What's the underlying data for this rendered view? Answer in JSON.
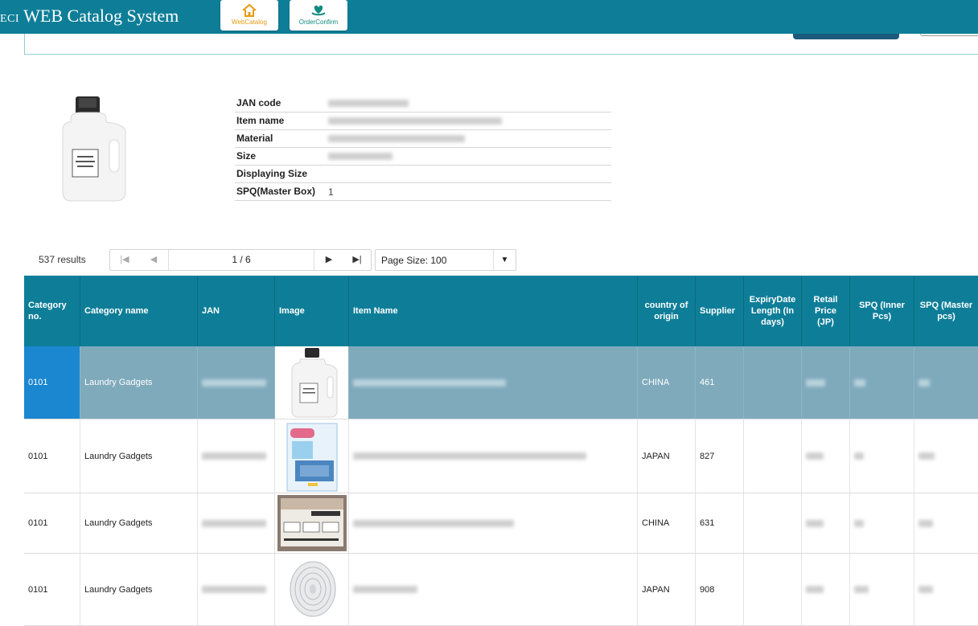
{
  "header": {
    "brand_prefix": "ECI",
    "brand_title": "WEB Catalog System",
    "nav": [
      {
        "label": "WebCatalog",
        "icon": "home-icon"
      },
      {
        "label": "OrderConfirm",
        "icon": "heart-hand-icon"
      }
    ]
  },
  "detail": {
    "image_icon": "detergent-bottle",
    "fields": [
      {
        "label": "JAN code",
        "value": ""
      },
      {
        "label": "Item name",
        "value": ""
      },
      {
        "label": "Material",
        "value": ""
      },
      {
        "label": "Size",
        "value": ""
      },
      {
        "label": "Displaying Size",
        "value": ""
      },
      {
        "label": "SPQ(Master Box)",
        "value": "1"
      }
    ]
  },
  "pager": {
    "results": "537 results",
    "page": "1 / 6",
    "page_size": "Page Size: 100"
  },
  "table": {
    "columns": [
      "Category no.",
      "Category name",
      "JAN",
      "Image",
      "Item Name",
      "country of origin",
      "Supplier",
      "ExpiryDate Length (In days)",
      "Retail Price (JP)",
      "SPQ (Inner Pcs)",
      "SPQ (Master pcs)"
    ],
    "rows": [
      {
        "category_no": "0101",
        "category_name": "Laundry Gadgets",
        "country": "CHINA",
        "supplier": "461",
        "image": "detergent-bottle",
        "selected": true
      },
      {
        "category_no": "0101",
        "category_name": "Laundry Gadgets",
        "country": "JAPAN",
        "supplier": "827",
        "image": "net-package",
        "selected": false
      },
      {
        "category_no": "0101",
        "category_name": "Laundry Gadgets",
        "country": "CHINA",
        "supplier": "631",
        "image": "label-stickers",
        "selected": false
      },
      {
        "category_no": "0101",
        "category_name": "Laundry Gadgets",
        "country": "JAPAN",
        "supplier": "908",
        "image": "spiral-disc",
        "selected": false
      }
    ]
  },
  "colors": {
    "header_bg": "#0e7e98",
    "selected_row": "#7faabc",
    "selected_cell": "#1b87d0"
  }
}
